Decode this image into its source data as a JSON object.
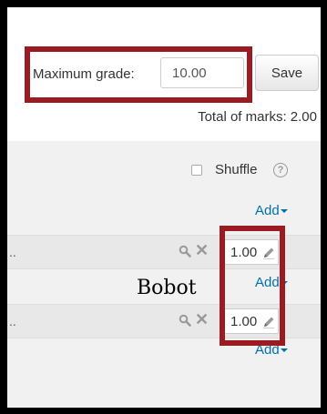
{
  "grade": {
    "label": "Maximum grade:",
    "value": "10.00",
    "save_label": "Save",
    "total_marks": "Total of marks: 2.00"
  },
  "section": {
    "shuffle_label": "Shuffle",
    "help_glyph": "?",
    "add_label": "Add"
  },
  "slots": [
    {
      "dots": "..",
      "mark": "1.00",
      "add_label": "Add"
    },
    {
      "dots": "..",
      "mark": "1.00",
      "add_label": "Add"
    }
  ],
  "annotation": {
    "label": "Bobot"
  },
  "colors": {
    "highlight_border": "#9a1c22",
    "link": "#0070a8",
    "frame": "#000000"
  },
  "icons": {
    "preview": "search-icon",
    "remove": "close-icon",
    "edit": "pencil-icon",
    "help": "help-icon"
  }
}
